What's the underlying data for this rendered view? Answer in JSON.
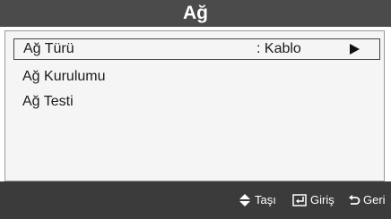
{
  "header": {
    "title": "Ağ"
  },
  "menu": {
    "items": [
      {
        "label": "Ağ Türü",
        "value": ": Kablo",
        "selected": true
      },
      {
        "label": "Ağ Kurulumu"
      },
      {
        "label": "Ağ Testi"
      }
    ]
  },
  "footer": {
    "move": {
      "icon": "up-down-arrow-icon",
      "label": "Taşı"
    },
    "enter": {
      "icon": "enter-icon",
      "label": "Giriş"
    },
    "back": {
      "icon": "return-icon",
      "label": "Geri"
    }
  },
  "colors": {
    "header_bg": "#4b4b4b",
    "footer_bg": "#3b3b3b",
    "panel_bg": "#f5f5f5"
  }
}
